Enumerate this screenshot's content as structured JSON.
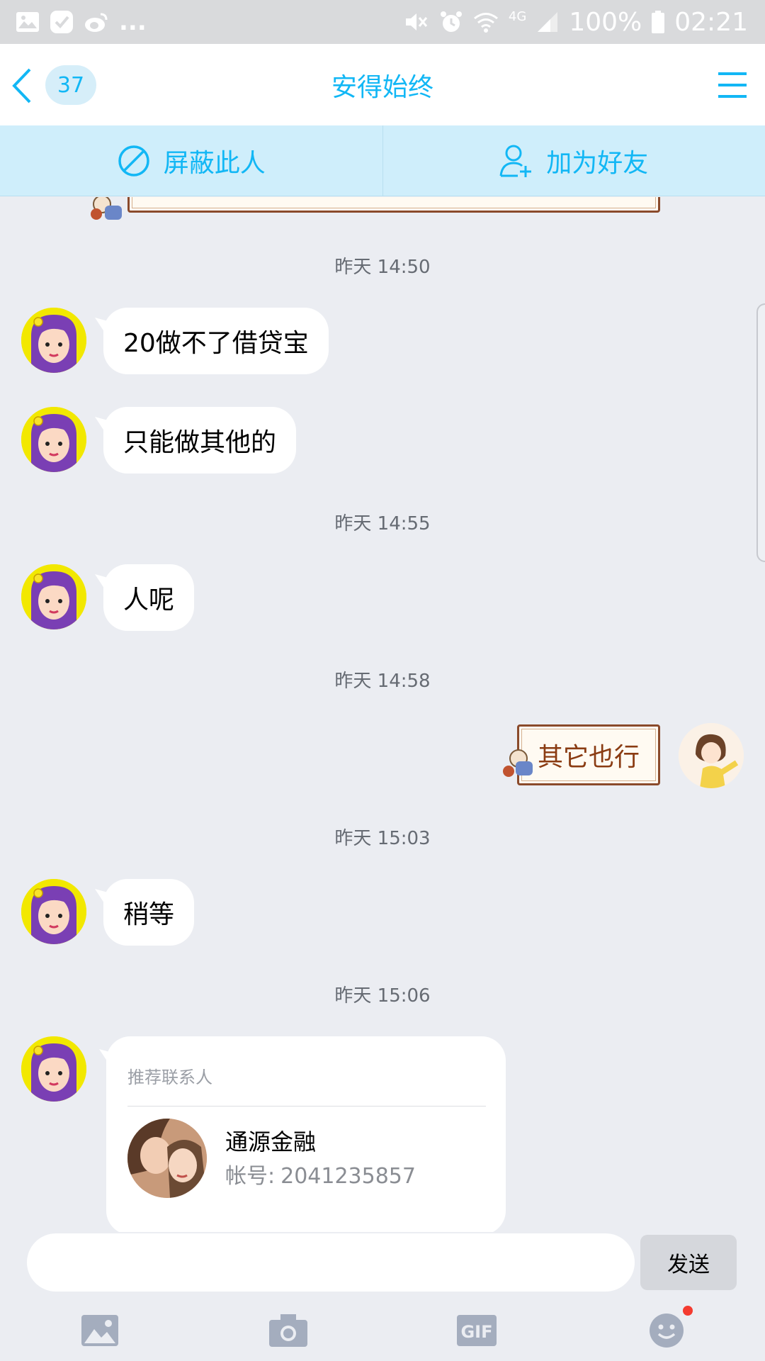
{
  "status_bar": {
    "dots": "...",
    "network": "4G",
    "battery": "100%",
    "time": "02:21"
  },
  "header": {
    "unread_count": "37",
    "title": "安得始终"
  },
  "actions": {
    "block": "屏蔽此人",
    "add_friend": "加为好友"
  },
  "messages": [
    {
      "type": "timestamp",
      "text": "昨天 14:50"
    },
    {
      "type": "incoming",
      "text": "20做不了借贷宝"
    },
    {
      "type": "incoming",
      "text": "只能做其他的"
    },
    {
      "type": "timestamp",
      "text": "昨天 14:55"
    },
    {
      "type": "incoming",
      "text": "人呢"
    },
    {
      "type": "timestamp",
      "text": "昨天 14:58"
    },
    {
      "type": "outgoing",
      "text": "其它也行"
    },
    {
      "type": "timestamp",
      "text": "昨天 15:03"
    },
    {
      "type": "incoming",
      "text": "稍等"
    },
    {
      "type": "timestamp",
      "text": "昨天 15:06"
    }
  ],
  "contact_card": {
    "label": "推荐联系人",
    "name": "通源金融",
    "account_label": "帐号:",
    "account_value": "2041235857"
  },
  "input": {
    "placeholder": "",
    "send_label": "发送"
  },
  "toolbar": {
    "gif_label": "GIF"
  },
  "colors": {
    "accent": "#12b7f5",
    "background": "#ebedf2",
    "action_strip": "#cfeefb"
  }
}
